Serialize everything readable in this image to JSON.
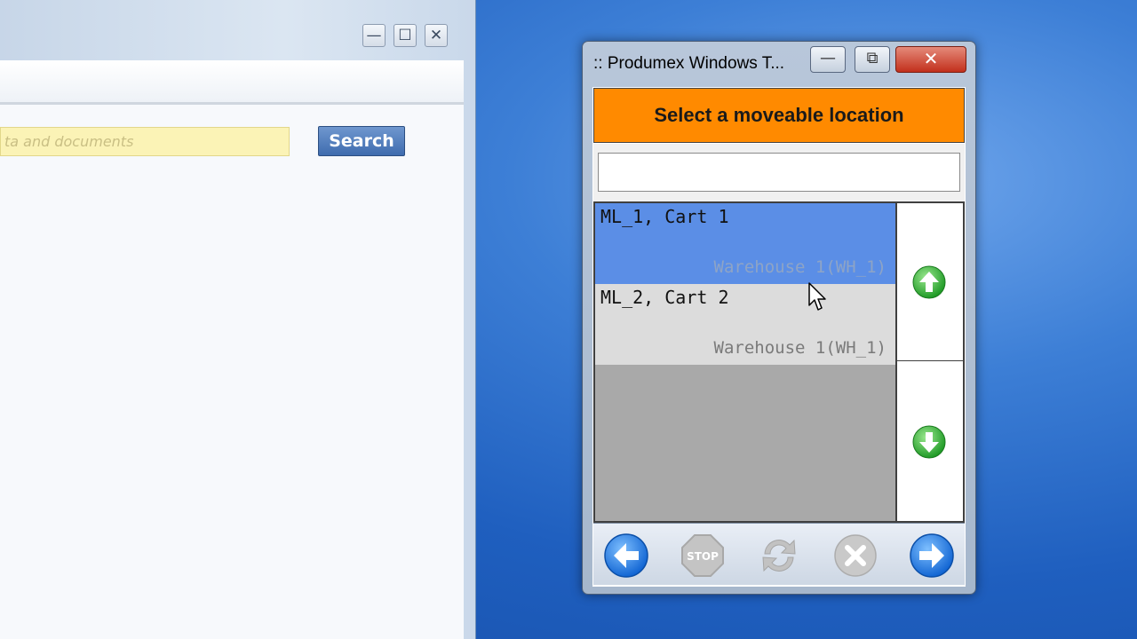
{
  "background_window": {
    "controls": {
      "minimize_label": "—",
      "maximize_label": "☐",
      "close_label": "✕"
    },
    "search": {
      "placeholder": "ta and documents",
      "button_label": "Search"
    }
  },
  "produmex": {
    "title": ":: Produmex Windows T...",
    "controls": {
      "minimize_label": "—",
      "maximize_label": "⧉",
      "close_label": "✕"
    },
    "header": "Select a moveable location",
    "input_value": "",
    "locations": [
      {
        "name": "ML_1, Cart 1",
        "warehouse": "Warehouse 1(WH_1)",
        "selected": true
      },
      {
        "name": "ML_2, Cart 2",
        "warehouse": "Warehouse 1(WH_1)",
        "selected": false
      }
    ],
    "scroll": {
      "up_icon": "arrow-up-green-icon",
      "down_icon": "arrow-down-green-icon"
    },
    "toolbar": {
      "back_icon": "arrow-left-blue-icon",
      "stop_label": "STOP",
      "refresh_icon": "refresh-icon",
      "cancel_icon": "cancel-x-icon",
      "next_icon": "arrow-right-blue-icon"
    },
    "colors": {
      "header_bg": "#ff8a00",
      "selected_row": "#5b8ee6",
      "row_bg": "#dcdcdc",
      "empty_list_bg": "#a9a9a9",
      "nav_blue": "#1e73e0",
      "arrow_green": "#2fae2f"
    }
  }
}
